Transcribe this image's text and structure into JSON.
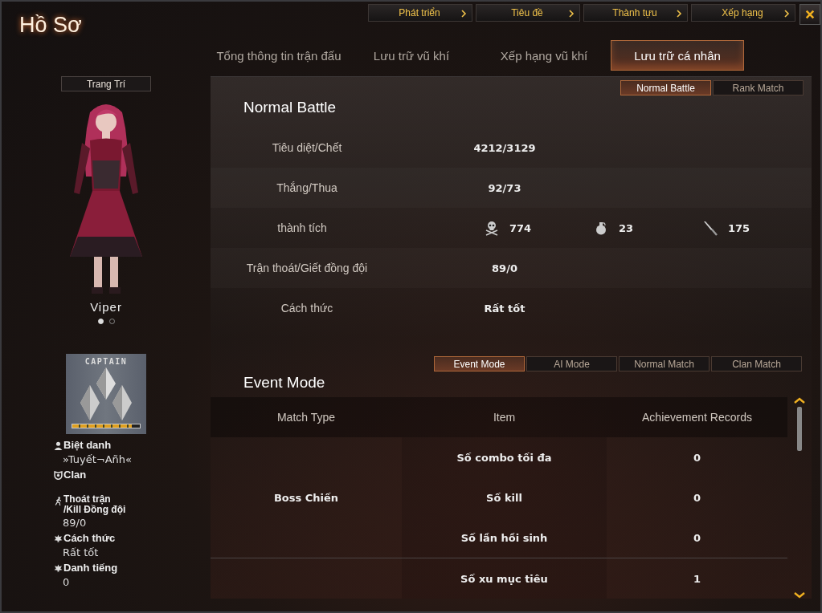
{
  "window": {
    "title": "Hồ Sơ"
  },
  "top_nav": [
    {
      "label": "Phát triển"
    },
    {
      "label": "Tiêu đề"
    },
    {
      "label": "Thành tựu"
    },
    {
      "label": "Xếp hạng"
    }
  ],
  "tabs": [
    {
      "label": "Tổng thông tin trận đấu",
      "selected": false
    },
    {
      "label": "Lưu trữ vũ khí",
      "selected": false
    },
    {
      "label": "Xếp hạng vũ khí",
      "selected": false
    },
    {
      "label": "Lưu trữ cá nhân",
      "selected": true
    }
  ],
  "sidebar": {
    "decorate_button": "Trang Trí",
    "character_name": "Viper",
    "pages": [
      {
        "selected": true
      },
      {
        "selected": false
      }
    ],
    "rank_badge": {
      "title": "CAPTAIN",
      "level": 0.875
    },
    "info": [
      {
        "kind": "person",
        "lines": [
          "Biệt danh"
        ],
        "value": "»Tuyết¬Añh«"
      },
      {
        "kind": "clan",
        "lines": [
          "Clan"
        ]
      },
      {
        "kind": "runner",
        "lines": [
          "Thoát trận",
          "/Kill Đồng đội"
        ],
        "value": "89/0"
      },
      {
        "kind": "leaf",
        "lines": [
          "Cách thức"
        ],
        "value": "Rất tốt"
      },
      {
        "kind": "leaf",
        "lines": [
          "Danh tiếng"
        ],
        "value": "0"
      }
    ]
  },
  "normal_section": {
    "tabs": [
      {
        "label": "Normal Battle",
        "selected": true
      },
      {
        "label": "Rank Match",
        "selected": false
      }
    ],
    "heading": "Normal Battle",
    "stats": [
      {
        "kind": "text",
        "label": "Tiêu diệt/Chết",
        "value": "4212/3129"
      },
      {
        "kind": "text",
        "label": "Thắng/Thua",
        "value": "92/73"
      },
      {
        "kind": "icons",
        "label": "thành tích",
        "items": [
          {
            "kind": "skull",
            "value": "774"
          },
          {
            "kind": "grenade",
            "value": "23"
          },
          {
            "kind": "knife",
            "value": "175"
          }
        ]
      },
      {
        "kind": "text",
        "label": "Trận thoát/Giết đồng đội",
        "value": "89/0"
      },
      {
        "kind": "text",
        "label": "Cách thức",
        "value": "Rất tốt"
      }
    ]
  },
  "event_section": {
    "tabs": [
      {
        "label": "Event Mode",
        "selected": true
      },
      {
        "label": "AI Mode",
        "selected": false
      },
      {
        "label": "Normal Match",
        "selected": false
      },
      {
        "label": "Clan Match",
        "selected": false
      }
    ],
    "heading": "Event Mode",
    "table": {
      "columns": [
        "Match Type",
        "Item",
        "Achievement Records"
      ],
      "groups": [
        {
          "match_type": "Boss Chiến",
          "rows": [
            {
              "item": "Số combo tối đa",
              "record": "0"
            },
            {
              "item": "Số kill",
              "record": "0"
            },
            {
              "item": "Số lần hồi sinh",
              "record": "0"
            }
          ]
        },
        {
          "rows": [
            {
              "item": "Số xu mục tiêu",
              "record": "1"
            }
          ]
        }
      ]
    }
  }
}
